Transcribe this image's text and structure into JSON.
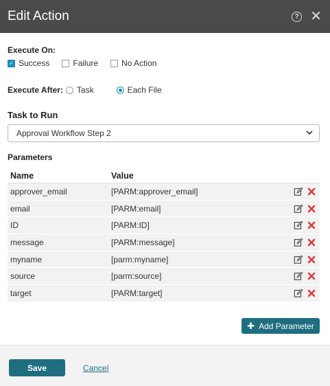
{
  "dialog": {
    "title": "Edit Action",
    "help_icon": "help-circle-icon",
    "close_icon": "close-icon"
  },
  "execute_on": {
    "label": "Execute On:",
    "options": [
      {
        "label": "Success",
        "checked": true
      },
      {
        "label": "Failure",
        "checked": false
      },
      {
        "label": "No Action",
        "checked": false
      }
    ]
  },
  "execute_after": {
    "label": "Execute After:",
    "options": [
      {
        "label": "Task",
        "selected": false
      },
      {
        "label": "Each File",
        "selected": true
      }
    ]
  },
  "task": {
    "label": "Task to Run",
    "selected": "Approval Workflow Step 2"
  },
  "parameters": {
    "label": "Parameters",
    "columns": [
      "Name",
      "Value"
    ],
    "rows": [
      {
        "name": "approver_email",
        "value": "[PARM:approver_email]"
      },
      {
        "name": "email",
        "value": "[PARM:email]"
      },
      {
        "name": "ID",
        "value": "[PARM:ID]"
      },
      {
        "name": "message",
        "value": "[PARM:message]"
      },
      {
        "name": "myname",
        "value": "[parm:myname]"
      },
      {
        "name": "source",
        "value": "[parm:source]"
      },
      {
        "name": "target",
        "value": "[PARM:target]"
      }
    ],
    "add_label": "Add Parameter"
  },
  "footer": {
    "save_label": "Save",
    "cancel_label": "Cancel"
  },
  "colors": {
    "header_bg": "#4a4a4a",
    "primary": "#1e6e80",
    "check_accent": "#1a8cbf",
    "delete_red": "#e0393e"
  }
}
